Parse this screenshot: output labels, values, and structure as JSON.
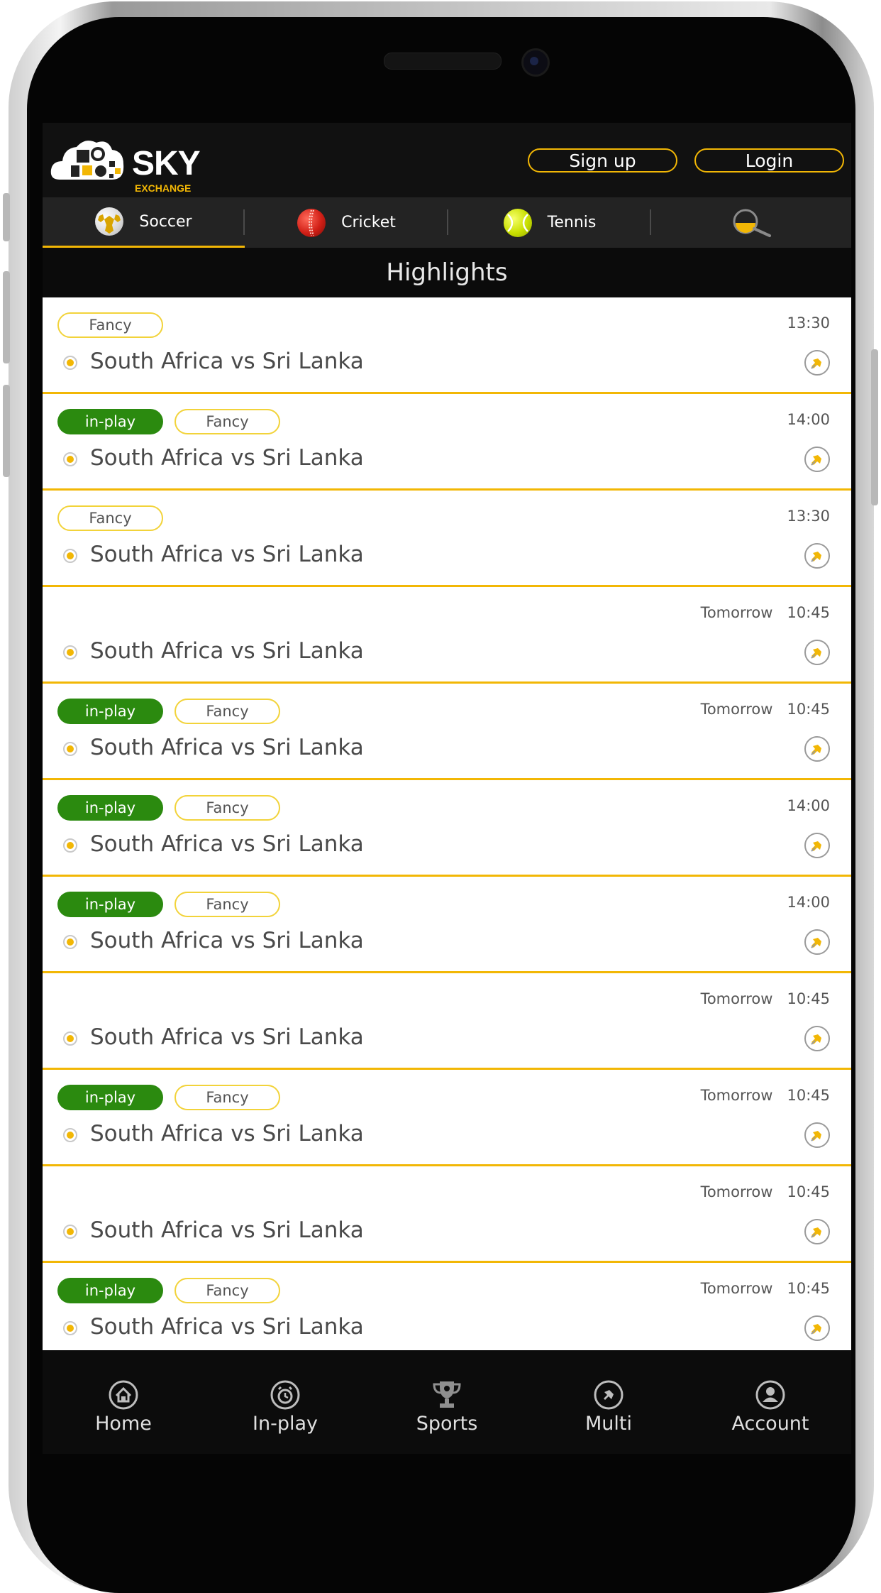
{
  "brand": {
    "name": "SKY",
    "sub": "EXCHANGE"
  },
  "header": {
    "signup_label": "Sign up",
    "login_label": "Login"
  },
  "tabs": [
    {
      "label": "Soccer",
      "icon": "soccer-ball-icon"
    },
    {
      "label": "Cricket",
      "icon": "cricket-ball-icon"
    },
    {
      "label": "Tennis",
      "icon": "tennis-ball-icon"
    },
    {
      "label": "",
      "icon": "search-icon"
    }
  ],
  "highlights_title": "Highlights",
  "badges": {
    "inplay": "in-play",
    "fancy": "Fancy"
  },
  "matches": [
    {
      "inplay": false,
      "fancy": true,
      "time": "13:30",
      "name": "South Africa vs Sri Lanka"
    },
    {
      "inplay": true,
      "fancy": true,
      "time": "14:00",
      "name": "South Africa vs Sri Lanka"
    },
    {
      "inplay": false,
      "fancy": true,
      "time": "13:30",
      "name": "South Africa vs Sri Lanka"
    },
    {
      "inplay": false,
      "fancy": false,
      "time": "Tomorrow   10:45",
      "name": "South Africa vs Sri Lanka"
    },
    {
      "inplay": true,
      "fancy": true,
      "time": "Tomorrow   10:45",
      "name": "South Africa vs Sri Lanka"
    },
    {
      "inplay": true,
      "fancy": true,
      "time": "14:00",
      "name": "South Africa vs Sri Lanka"
    },
    {
      "inplay": true,
      "fancy": true,
      "time": "14:00",
      "name": "South Africa vs Sri Lanka"
    },
    {
      "inplay": false,
      "fancy": false,
      "time": "Tomorrow   10:45",
      "name": "South Africa vs Sri Lanka"
    },
    {
      "inplay": true,
      "fancy": true,
      "time": "Tomorrow   10:45",
      "name": "South Africa vs Sri Lanka"
    },
    {
      "inplay": false,
      "fancy": false,
      "time": "Tomorrow   10:45",
      "name": "South Africa vs Sri Lanka"
    },
    {
      "inplay": true,
      "fancy": true,
      "time": "Tomorrow   10:45",
      "name": "South Africa vs Sri Lanka"
    }
  ],
  "bottom_nav": [
    {
      "label": "Home",
      "icon": "home-icon"
    },
    {
      "label": "In-play",
      "icon": "alarm-clock-icon"
    },
    {
      "label": "Sports",
      "icon": "trophy-icon"
    },
    {
      "label": "Multi",
      "icon": "pin-icon"
    },
    {
      "label": "Account",
      "icon": "account-icon"
    }
  ],
  "colors": {
    "accent": "#f2b705",
    "inplay_green": "#2b8a0f",
    "header_bg": "#111111",
    "tabs_bg": "#232323"
  }
}
